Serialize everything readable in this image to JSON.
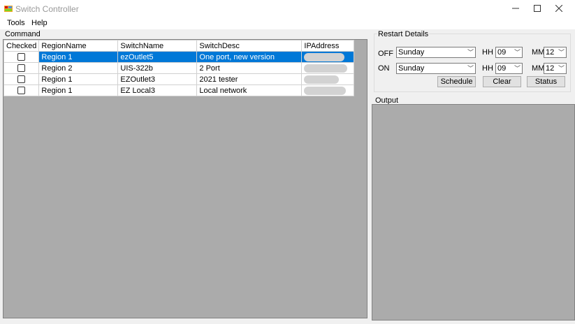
{
  "window": {
    "title": "Switch Controller"
  },
  "menu": {
    "items": [
      "Tools",
      "Help"
    ]
  },
  "command": {
    "label": "Command",
    "columns": [
      "Checked",
      "RegionName",
      "SwitchName",
      "SwitchDesc",
      "IPAddress"
    ],
    "rows": [
      {
        "checked": false,
        "region": "Region 1",
        "switch": "ezOutlet5",
        "desc": "One port, new version",
        "selected": true
      },
      {
        "checked": false,
        "region": "Region 2",
        "switch": "UIS-322b",
        "desc": "2 Port",
        "selected": false
      },
      {
        "checked": false,
        "region": "Region 1",
        "switch": "EZOutlet3",
        "desc": "2021 tester",
        "selected": false
      },
      {
        "checked": false,
        "region": "Region 1",
        "switch": "EZ Local3",
        "desc": "Local network",
        "selected": false
      }
    ]
  },
  "restart": {
    "label": "Restart Details",
    "off_label": "OFF",
    "on_label": "ON",
    "off_day": "Sunday",
    "on_day": "Sunday",
    "hh_label": "HH",
    "mm_label": "MM",
    "off_hh": "09",
    "off_mm": "12",
    "on_hh": "09",
    "on_mm": "12",
    "schedule_label": "Schedule",
    "clear_label": "Clear",
    "status_label": "Status"
  },
  "output": {
    "label": "Output"
  },
  "colors": {
    "selection": "#0078d7",
    "empty_area": "#ababab"
  }
}
